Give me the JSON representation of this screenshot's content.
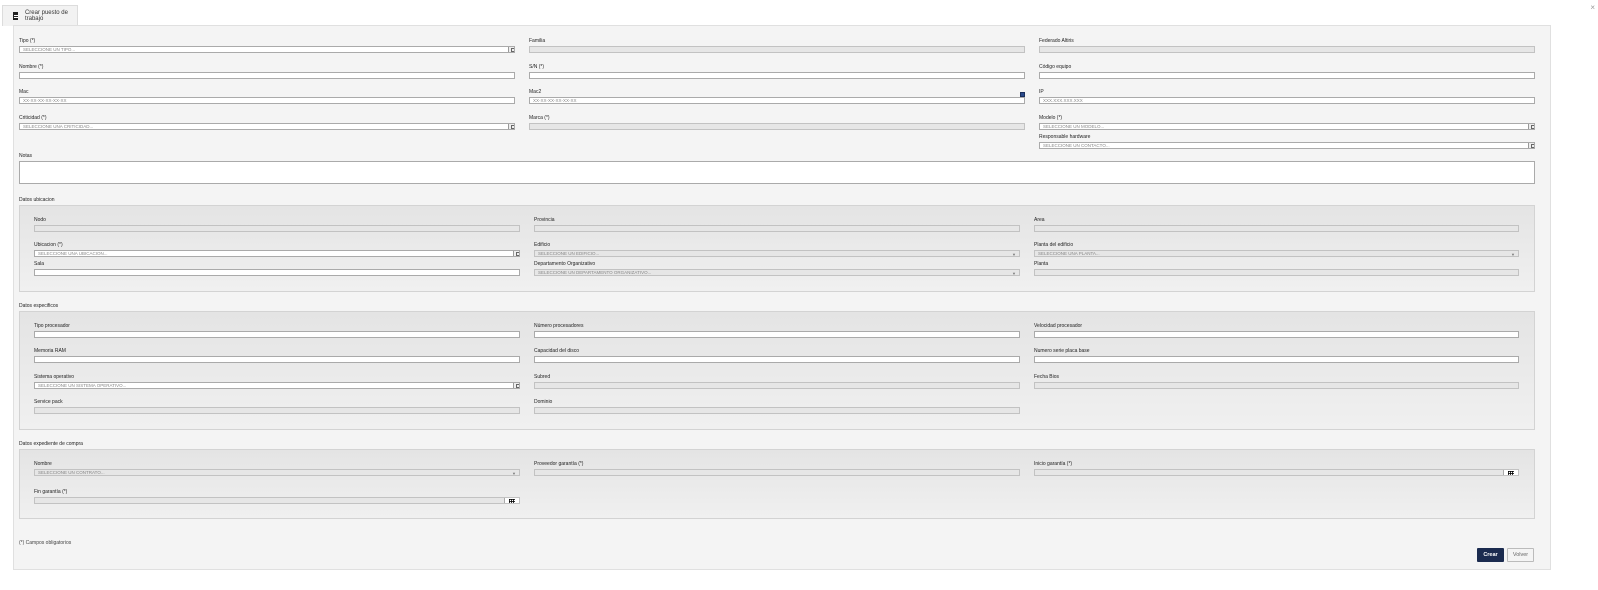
{
  "tab": {
    "label": "Crear puesto de trabajo",
    "icon": "document-icon"
  },
  "close_label": "×",
  "general": {
    "tipo": {
      "label": "Tipo (*)",
      "placeholder": "SELECCIONE UN TIPO..."
    },
    "familia": {
      "label": "Familia"
    },
    "federado": {
      "label": "Federado Altiris"
    },
    "nombre": {
      "label": "Nombre (*)"
    },
    "sn": {
      "label": "S/N (*)"
    },
    "codigo_equipo": {
      "label": "Código equipo"
    },
    "mac": {
      "label": "Mac",
      "placeholder": "XX-XX-XX-XX-XX-XX"
    },
    "mac2": {
      "label": "Mac2",
      "placeholder": "XX-XX-XX-XX-XX-XX"
    },
    "ip": {
      "label": "IP",
      "placeholder": "XXX.XXX.XXX.XXX"
    },
    "criticidad": {
      "label": "Criticidad (*)",
      "placeholder": "SELECCIONE UNA CRITICIDAD..."
    },
    "marca": {
      "label": "Marca (*)"
    },
    "modelo": {
      "label": "Modelo (*)",
      "placeholder": "SELECCIONE UN MODELO..."
    },
    "responsable": {
      "label": "Responsable hardware",
      "placeholder": "SELECCIONE UN CONTACTO..."
    },
    "notas": {
      "label": "Notas"
    }
  },
  "ubicacion": {
    "title": "Datos ubicacion",
    "nodo": {
      "label": "Nodo"
    },
    "provincia": {
      "label": "Provincia"
    },
    "area": {
      "label": "Area"
    },
    "ubicacion": {
      "label": "Ubicacion (*)",
      "placeholder": "SELECCIONE UNA UBICACION..."
    },
    "edificio": {
      "label": "Edificio",
      "placeholder": "SELECCIONE UN EDIFICIO..."
    },
    "planta_edificio": {
      "label": "Planta del edificio",
      "placeholder": "SELECCIONE UNA PLANTA..."
    },
    "sala": {
      "label": "Sala"
    },
    "departamento": {
      "label": "Departamento Organizativo",
      "placeholder": "SELECCIONE UN DEPARTAMENTO ORGANIZATIVO..."
    },
    "planta": {
      "label": "Planta"
    }
  },
  "especificos": {
    "title": "Datos especificos",
    "tipo_procesador": {
      "label": "Tipo procesador"
    },
    "numero_procesadores": {
      "label": "Número procesadores"
    },
    "velocidad_procesador": {
      "label": "Velocidad procesador"
    },
    "memoria_ram": {
      "label": "Memoria RAM"
    },
    "capacidad_disco": {
      "label": "Capacidad del disco"
    },
    "numero_serie_placa": {
      "label": "Numero serie placa base"
    },
    "sistema_operativo": {
      "label": "Sistema operativo",
      "placeholder": "SELECCIONE UN SISTEMA OPERATIVO..."
    },
    "subred": {
      "label": "Subred"
    },
    "fecha_bios": {
      "label": "Fecha Bios"
    },
    "service_pack": {
      "label": "Service pack"
    },
    "dominio": {
      "label": "Dominio"
    }
  },
  "compra": {
    "title": "Datos expediente de compra",
    "nombre": {
      "label": "Nombre",
      "placeholder": "SELECCIONE UN CONTRATO..."
    },
    "proveedor": {
      "label": "Proveedor garantía (*)"
    },
    "inicio": {
      "label": "Inicio garantía (*)"
    },
    "fin": {
      "label": "Fin garantía (*)"
    }
  },
  "footnote": "(*) Campos obligatorios",
  "buttons": {
    "crear": "Crear",
    "volver": "Volver"
  }
}
